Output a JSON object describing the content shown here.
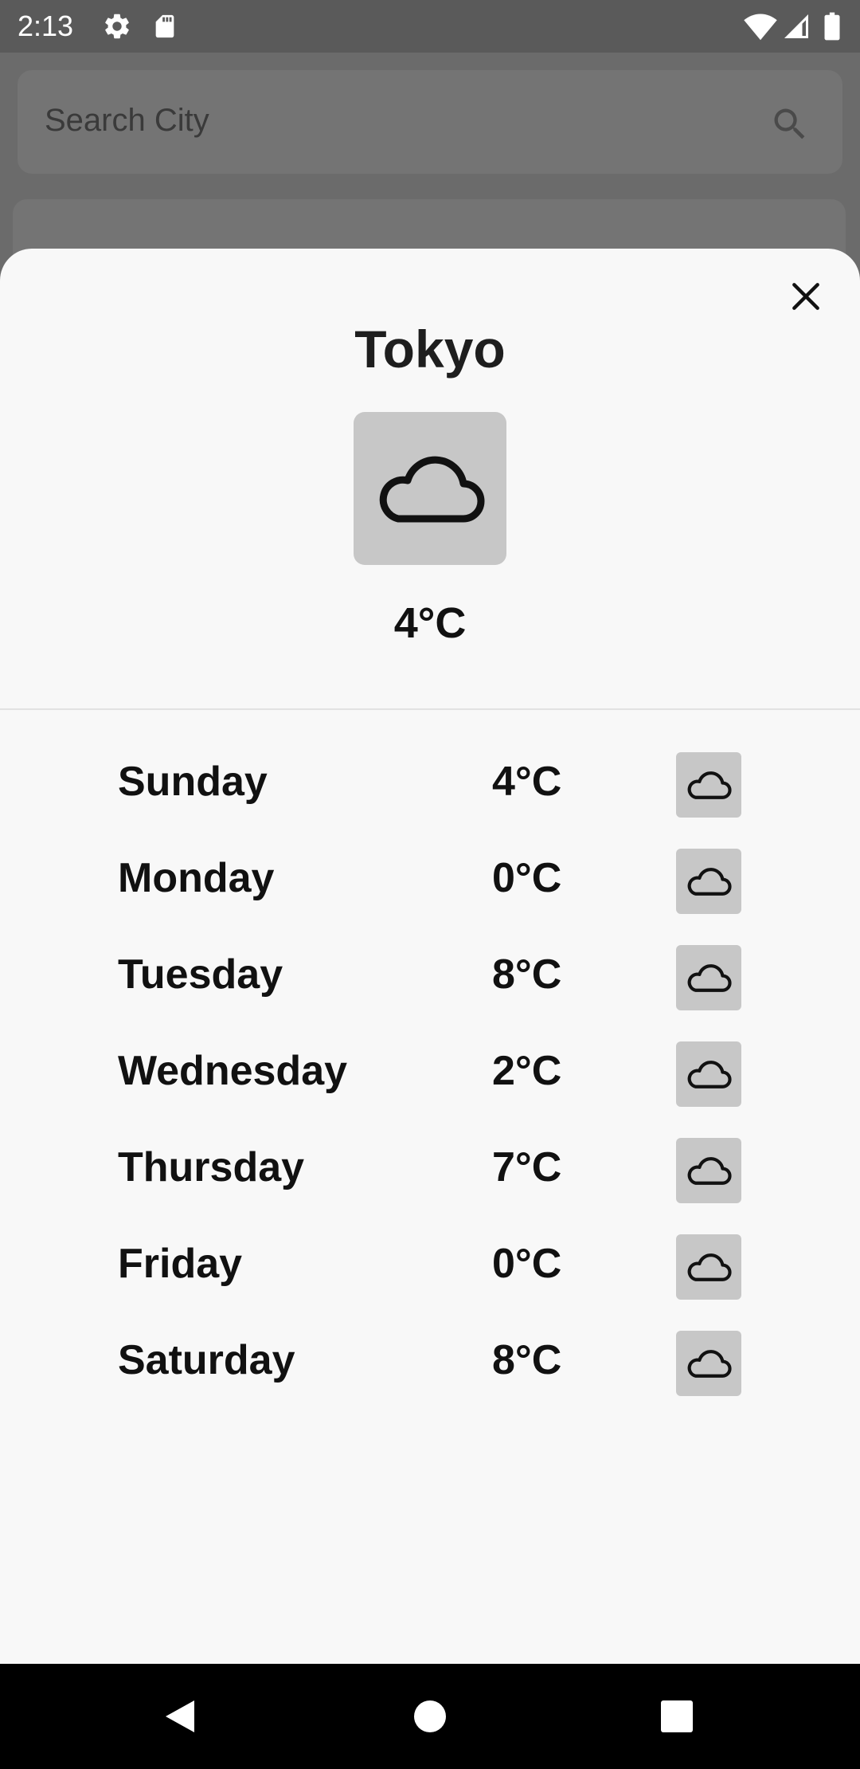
{
  "status_bar": {
    "time": "2:13",
    "icons": [
      "gear-icon",
      "sd-card-icon",
      "wifi-icon",
      "signal-icon",
      "battery-icon"
    ]
  },
  "background_app": {
    "search": {
      "placeholder": "Search City",
      "icon": "search-icon"
    }
  },
  "sheet": {
    "close_icon": "close-icon",
    "city": "Tokyo",
    "current_icon": "cloud-icon",
    "current_temp": "4°C",
    "forecast": [
      {
        "day": "Sunday",
        "temp": "4°C",
        "icon": "cloud-icon"
      },
      {
        "day": "Monday",
        "temp": "0°C",
        "icon": "cloud-icon"
      },
      {
        "day": "Tuesday",
        "temp": "8°C",
        "icon": "cloud-icon"
      },
      {
        "day": "Wednesday",
        "temp": "2°C",
        "icon": "cloud-icon"
      },
      {
        "day": "Thursday",
        "temp": "7°C",
        "icon": "cloud-icon"
      },
      {
        "day": "Friday",
        "temp": "0°C",
        "icon": "cloud-icon"
      },
      {
        "day": "Saturday",
        "temp": "8°C",
        "icon": "cloud-icon"
      }
    ]
  },
  "nav_bar": {
    "buttons": [
      "back-icon",
      "home-icon",
      "recents-icon"
    ]
  },
  "colors": {
    "scrim": "#6b6b6b",
    "sheet_bg": "#f8f8f8",
    "icon_box": "#c7c7c7",
    "text": "#111111"
  }
}
